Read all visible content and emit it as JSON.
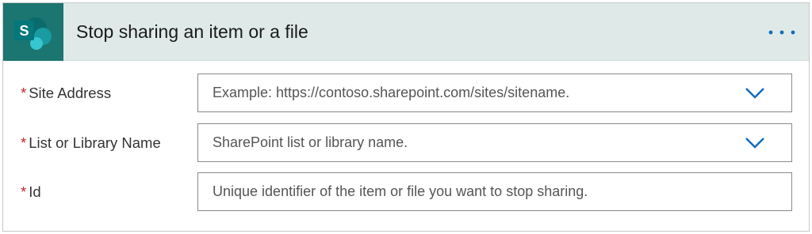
{
  "header": {
    "title": "Stop sharing an item or a file",
    "logo_letter": "S",
    "logo_icon": "sharepoint-icon",
    "more_icon": "more-options-icon"
  },
  "colors": {
    "header_bg": "#dfeae8",
    "logo_bg": "#1b7571",
    "accent": "#0f6cbd",
    "required": "#c4262e"
  },
  "fields": [
    {
      "label": "Site Address",
      "required_mark": "*",
      "placeholder": "Example: https://contoso.sharepoint.com/sites/sitename.",
      "value": "",
      "dropdown": true
    },
    {
      "label": "List or Library Name",
      "required_mark": "*",
      "placeholder": "SharePoint list or library name.",
      "value": "",
      "dropdown": true
    },
    {
      "label": "Id",
      "required_mark": "*",
      "placeholder": "Unique identifier of the item or file you want to stop sharing.",
      "value": "",
      "dropdown": false
    }
  ]
}
